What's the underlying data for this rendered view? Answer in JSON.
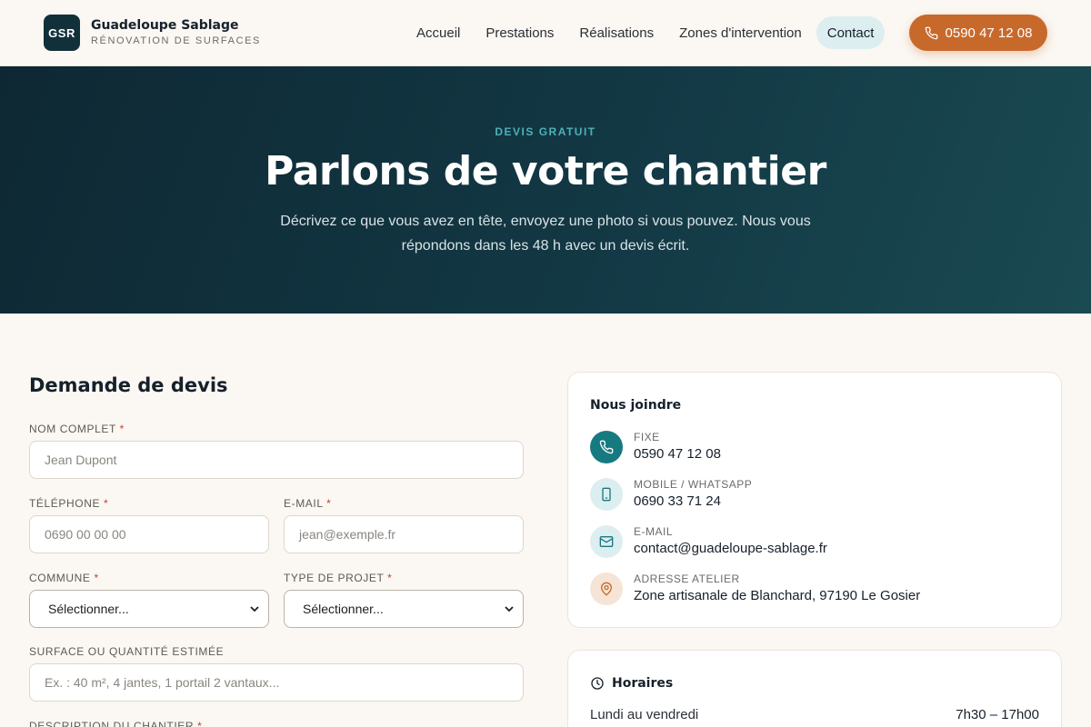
{
  "header": {
    "logo_initials": "GSR",
    "brand_name": "Guadeloupe Sablage",
    "brand_subtitle": "RÉNOVATION DE SURFACES",
    "nav": [
      "Accueil",
      "Prestations",
      "Réalisations",
      "Zones d'intervention",
      "Contact"
    ],
    "active_nav": "Contact",
    "phone_cta": "0590 47 12 08"
  },
  "hero": {
    "eyebrow": "DEVIS GRATUIT",
    "title": "Parlons de votre chantier",
    "text": "Décrivez ce que vous avez en tête, envoyez une photo si vous pouvez. Nous vous répondons dans les 48 h avec un devis écrit."
  },
  "form": {
    "title": "Demande de devis",
    "required_mark": "*",
    "name_label": "NOM COMPLET",
    "name_placeholder": "Jean Dupont",
    "phone_label": "TÉLÉPHONE",
    "phone_placeholder": "0690 00 00 00",
    "email_label": "E-MAIL",
    "email_placeholder": "jean@exemple.fr",
    "commune_label": "COMMUNE",
    "commune_value": "Sélectionner...",
    "project_label": "TYPE DE PROJET",
    "project_value": "Sélectionner...",
    "surface_label": "SURFACE OU QUANTITÉ ESTIMÉE",
    "surface_placeholder": "Ex. : 40 m², 4 jantes, 1 portail 2 vantaux...",
    "description_label": "DESCRIPTION DU CHANTIER"
  },
  "contact": {
    "title": "Nous joindre",
    "items": [
      {
        "label": "FIXE",
        "value": "0590 47 12 08",
        "icon": "phone-icon"
      },
      {
        "label": "MOBILE / WHATSAPP",
        "value": "0690 33 71 24",
        "icon": "mobile-icon"
      },
      {
        "label": "E-MAIL",
        "value": "contact@guadeloupe-sablage.fr",
        "icon": "mail-icon"
      },
      {
        "label": "ADRESSE ATELIER",
        "value": "Zone artisanale de Blanchard, 97190 Le Gosier",
        "icon": "map-pin-icon"
      }
    ]
  },
  "hours": {
    "title": "Horaires",
    "rows": [
      {
        "day": "Lundi au vendredi",
        "time": "7h30 – 17h00"
      }
    ]
  },
  "colors": {
    "accent_orange": "#c8692c",
    "teal": "#167a80",
    "hero_dark": "#0e2833"
  }
}
